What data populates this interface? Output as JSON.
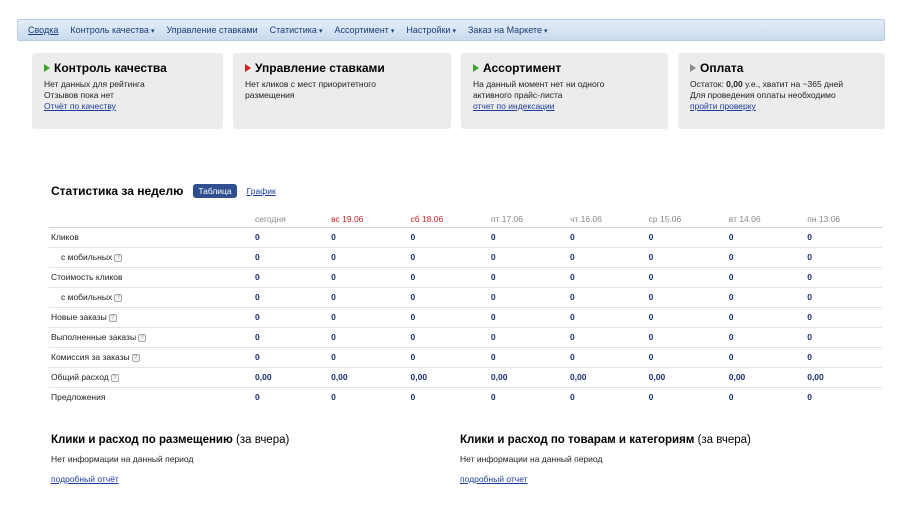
{
  "nav": {
    "items": [
      {
        "label": "Сводка",
        "caret": ""
      },
      {
        "label": "Контроль качества",
        "caret": "▾"
      },
      {
        "label": "Управление ставками",
        "caret": ""
      },
      {
        "label": "Статистика",
        "caret": "▾"
      },
      {
        "label": "Ассортимент",
        "caret": "▾"
      },
      {
        "label": "Настройки",
        "caret": "▾"
      },
      {
        "label": "Заказ на Маркете",
        "caret": "▾"
      }
    ]
  },
  "cards": {
    "quality": {
      "title": "Контроль качества",
      "line1": "Нет данных для рейтинга",
      "line2": "Отзывов пока нет",
      "link": "Отчёт по качеству",
      "arrow_color": "#3aa528"
    },
    "bids": {
      "title": "Управление ставками",
      "line1": "Нет кликов с мест приоритетного",
      "line2": "размещения",
      "arrow_color": "#e01b1b"
    },
    "assortment": {
      "title": "Ассортимент",
      "line1": "На данный момент нет ни одного",
      "line2": "активного прайс-листа",
      "link": "отчет по индексации",
      "arrow_color": "#3aa528"
    },
    "payment": {
      "title": "Оплата",
      "line1_prefix": "Остаток: ",
      "line1_amount": "0,00",
      "line1_suffix": " у.е., хватит на ~365 дней",
      "line2": "Для проведения оплаты необходимо",
      "link": "пройти проверку",
      "arrow_color": "#8a8a8a"
    }
  },
  "stats": {
    "title": "Статистика за неделю",
    "tab_table": "Таблица",
    "tab_graph": "График",
    "columns": [
      "сегодня",
      "вс 19.06",
      "сб 18.06",
      "пт 17.06",
      "чт 16.06",
      "ср 15.06",
      "вт 14.06",
      "пн 13.06"
    ],
    "rows": [
      {
        "label": "Кликов",
        "values": [
          "0",
          "0",
          "0",
          "0",
          "0",
          "0",
          "0",
          "0"
        ]
      },
      {
        "label": "с мобильных",
        "values": [
          "0",
          "0",
          "0",
          "0",
          "0",
          "0",
          "0",
          "0"
        ]
      },
      {
        "label": "Стоимость кликов",
        "values": [
          "0",
          "0",
          "0",
          "0",
          "0",
          "0",
          "0",
          "0"
        ]
      },
      {
        "label": "с мобильных",
        "values": [
          "0",
          "0",
          "0",
          "0",
          "0",
          "0",
          "0",
          "0"
        ]
      },
      {
        "label": "Новые заказы",
        "values": [
          "0",
          "0",
          "0",
          "0",
          "0",
          "0",
          "0",
          "0"
        ]
      },
      {
        "label": "Выполненные заказы",
        "values": [
          "0",
          "0",
          "0",
          "0",
          "0",
          "0",
          "0",
          "0"
        ]
      },
      {
        "label": "Комиссия за заказы",
        "values": [
          "0",
          "0",
          "0",
          "0",
          "0",
          "0",
          "0",
          "0"
        ]
      },
      {
        "label": "Общий расход",
        "values": [
          "0,00",
          "0,00",
          "0,00",
          "0,00",
          "0,00",
          "0,00",
          "0,00",
          "0,00"
        ]
      },
      {
        "label": "Предложения",
        "values": [
          "0",
          "0",
          "0",
          "0",
          "0",
          "0",
          "0",
          "0"
        ]
      }
    ],
    "weekend_color": "#d0202a"
  },
  "bottom": {
    "placement": {
      "title": "Клики и расход по размещению",
      "sub": "(за вчера)",
      "line": "Нет информации на данный период",
      "link": "подробный отчёт"
    },
    "goods": {
      "title": "Клики и расход по товарам и категориям",
      "sub": "(за вчера)",
      "line": "Нет информации на данный период",
      "link": "подробный отчет"
    }
  }
}
